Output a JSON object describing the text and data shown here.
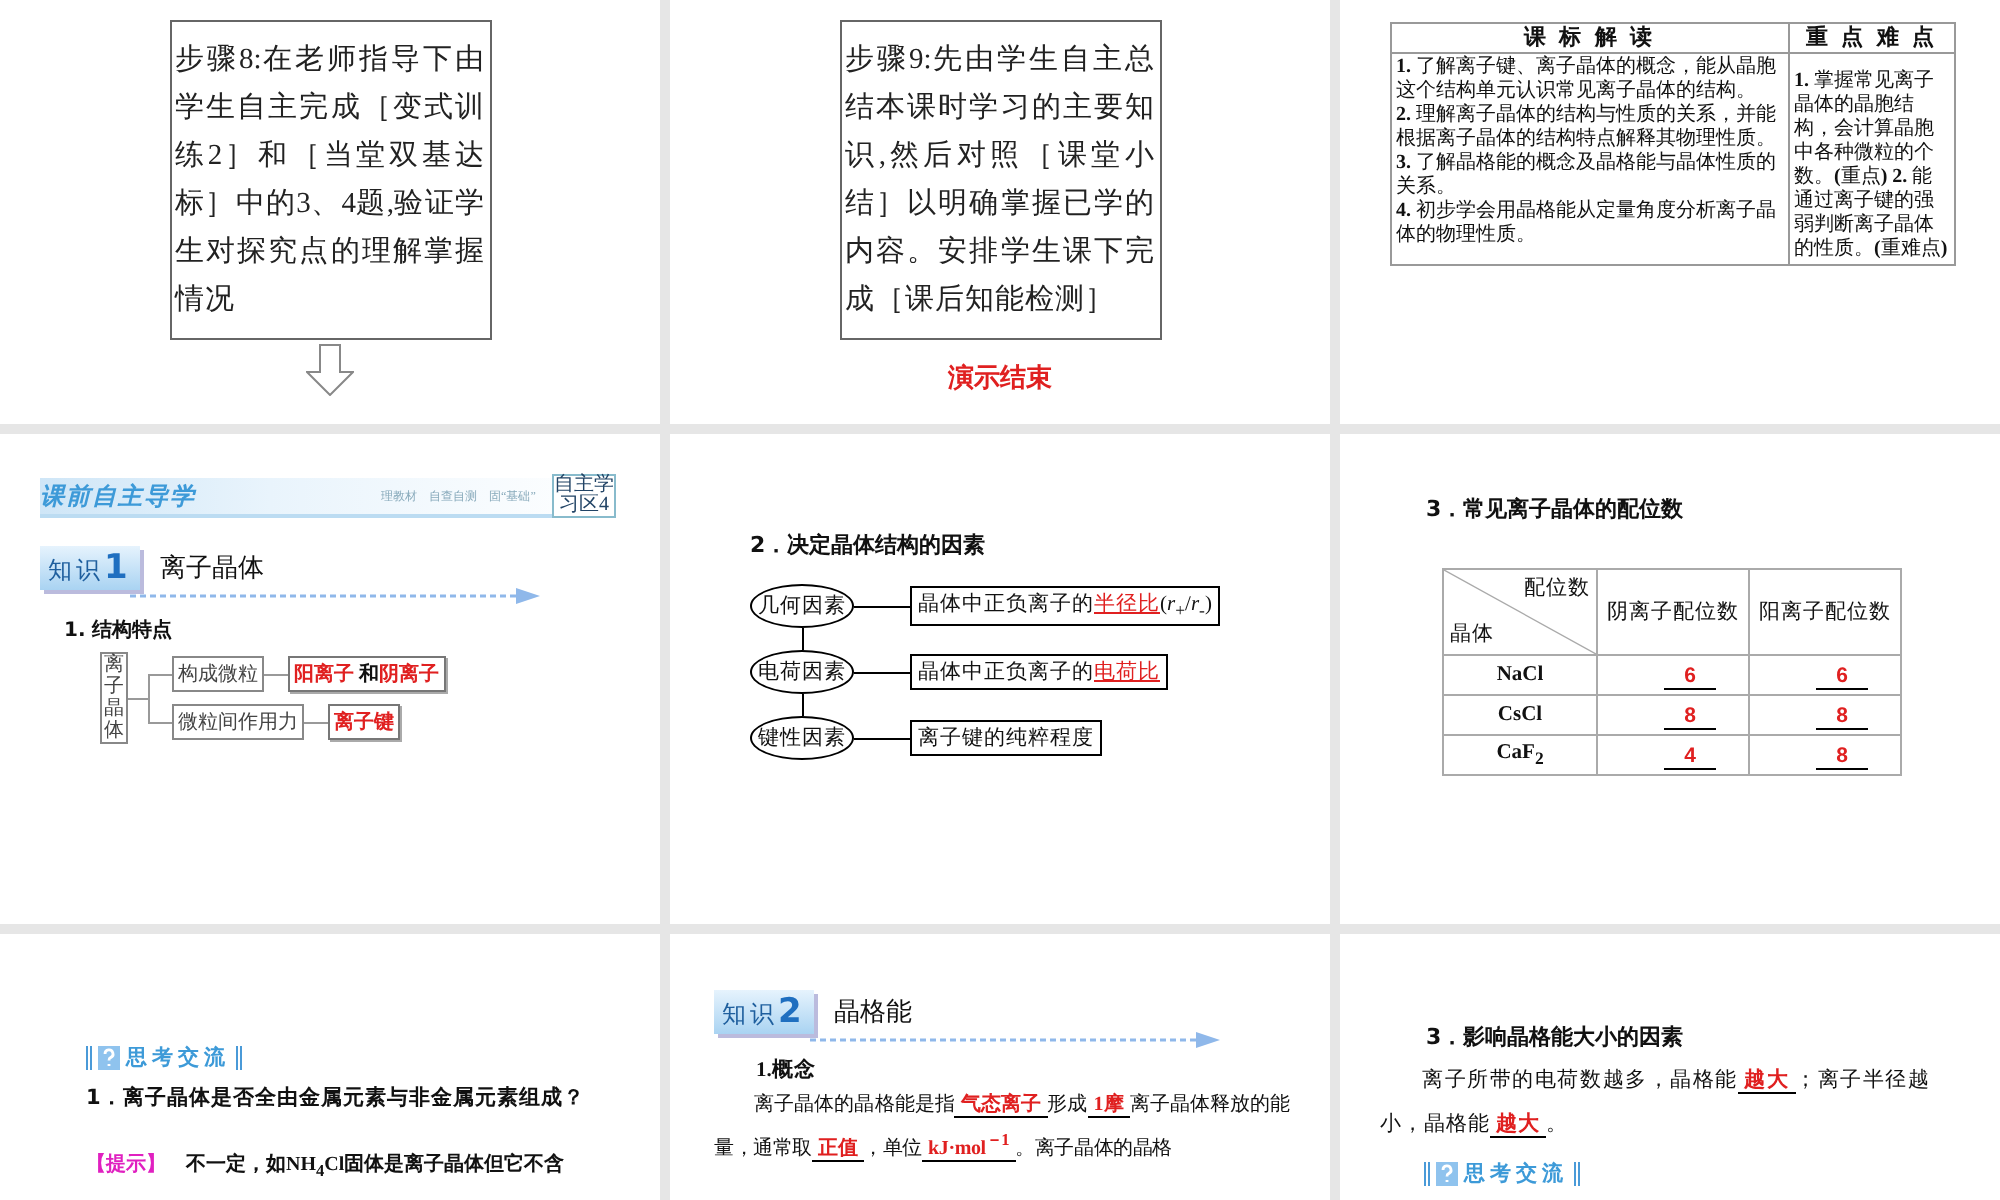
{
  "slides": [
    {
      "kind": "step_box",
      "text": "步骤8:在老师指导下由学生自主完成［变式训练2］和［当堂双基达标］中的3、4题,验证学生对探究点的理解掌握情况",
      "next_arrow": true
    },
    {
      "kind": "step_box",
      "text": "步骤9:先由学生自主总结本课时学习的主要知识,然后对照［课堂小结］以明确掌握已学的内容。安排学生课下完成［课后知能检测］",
      "next_arrow": false,
      "caption": "演示结束"
    },
    {
      "kind": "objectives_table",
      "columns": [
        "课 标 解 读",
        "重 点 难 点"
      ],
      "left": [
        "**1.** 了解离子键、离子晶体的概念，能从晶胞这个结构单元认识常见离子晶体的结构。",
        "**2.** 理解离子晶体的结构与性质的关系，并能根据离子晶体的结构特点解释其物理性质。",
        "**3.** 了解晶格能的概念及晶格能与晶体性质的关系。",
        "**4.** 初步学会用晶格能从定量角度分析离子晶体的物理性质。"
      ],
      "right": "**1.** 掌握常见离子晶体的晶胞结构，会计算晶胞中各种微粒的个数。**(**重点**) 2.** 能通过离子键的强弱判断离子晶体的性质。**(**重难点**)**"
    },
    {
      "kind": "knowledge_tree",
      "banner": {
        "title": "课前自主导学",
        "subtitle": "理教材　自查自测　固“基础”",
        "badge": "自主学习区4"
      },
      "badge_label": "知识",
      "badge_number": "1",
      "heading": "离子晶体",
      "subheading": "1.  结构特点",
      "root": "离子晶体",
      "branches": [
        {
          "label": "构成微粒",
          "answer": [
            {
              "kind": "blank",
              "text": "阳离子"
            },
            {
              "kind": "plain",
              "text": " 和"
            },
            {
              "kind": "blank",
              "text": "阴离子"
            }
          ]
        },
        {
          "label": "微粒间作用力",
          "answer": [
            {
              "kind": "blank",
              "text": "离子键"
            }
          ]
        }
      ]
    },
    {
      "kind": "factor_diagram",
      "heading": "2．决定晶体结构的因素",
      "factors": [
        {
          "name": "几何因素",
          "desc": [
            {
              "kind": "plain",
              "text": "晶体中正负离子的"
            },
            {
              "kind": "blank",
              "text": "半径比"
            },
            {
              "kind": "plain",
              "text": "(*r*$_{+}$/*r*$_{-}$)"
            }
          ]
        },
        {
          "name": "电荷因素",
          "desc": [
            {
              "kind": "plain",
              "text": "晶体中正负离子的"
            },
            {
              "kind": "blank",
              "text": "电荷比"
            }
          ]
        },
        {
          "name": "键性因素",
          "desc": [
            {
              "kind": "plain",
              "text": "离子键的纯粹程度"
            }
          ]
        }
      ]
    },
    {
      "kind": "coordination_table",
      "heading": "3．常见离子晶体的配位数",
      "corner_top": "配位数",
      "corner_bottom": "晶体",
      "columns": [
        "阴离子配位数",
        "阳离子配位数"
      ],
      "rows": [
        {
          "crystal": "NaCl",
          "values": [
            "6",
            "6"
          ]
        },
        {
          "crystal": "CsCl",
          "values": [
            "8",
            "8"
          ]
        },
        {
          "crystal": "CaF$_{2}$",
          "values": [
            "4",
            "8"
          ]
        }
      ]
    },
    {
      "kind": "question",
      "header": "思考交流",
      "question": "1．离子晶体是否全由金属元素与非金属元素组成？",
      "hint_label": "【提示】",
      "hint": "不一定，如NH$_{4}$Cl固体是离子晶体但它不含"
    },
    {
      "kind": "lattice_energy",
      "badge_label": "知识",
      "badge_number": "2",
      "heading": "晶格能",
      "subheading": "1.概念",
      "paragraph": [
        {
          "kind": "plain",
          "text": "离子晶体的晶格能是指"
        },
        {
          "kind": "blank",
          "text": "气态离子"
        },
        {
          "kind": "plain",
          "text": "形成"
        },
        {
          "kind": "blank",
          "text": "1摩"
        },
        {
          "kind": "plain",
          "text": "离子晶体释放的能量，通常取"
        },
        {
          "kind": "blank",
          "text": "正值"
        },
        {
          "kind": "plain",
          "text": "，单位"
        },
        {
          "kind": "blank",
          "text": "kJ·mol$^{－1}$"
        },
        {
          "kind": "plain",
          "text": "。离子晶体的晶格"
        }
      ]
    },
    {
      "kind": "factors_text",
      "heading": "3．影响晶格能大小的因素",
      "paragraph": [
        {
          "kind": "plain",
          "text": "离子所带的电荷数越多，晶格能"
        },
        {
          "kind": "blank",
          "text": "越大"
        },
        {
          "kind": "plain",
          "text": "；离子半径越小，晶格能"
        },
        {
          "kind": "blank",
          "text": "越大"
        },
        {
          "kind": "plain",
          "text": "。"
        }
      ],
      "header": "思考交流"
    }
  ]
}
